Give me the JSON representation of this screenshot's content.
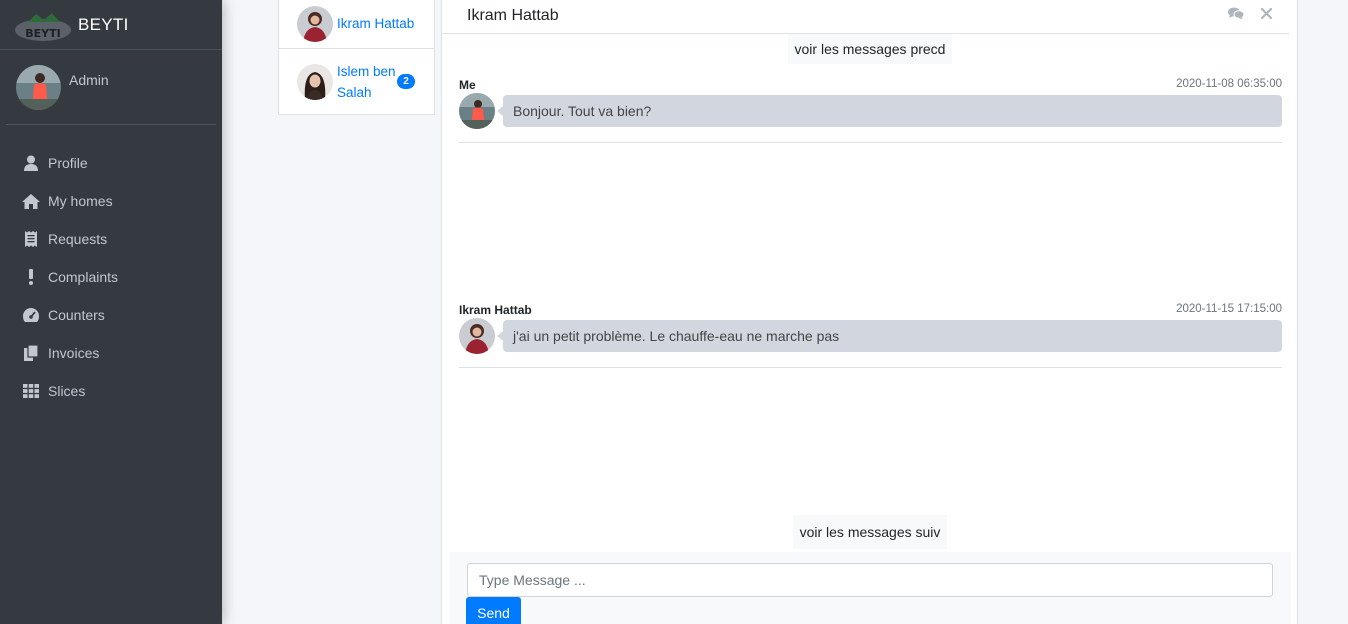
{
  "brand": {
    "name": "BEYTI",
    "logo_text": "BEYTI"
  },
  "user": {
    "name": "Admin"
  },
  "sidebar": {
    "items": [
      {
        "label": "Profile",
        "icon": "user-icon"
      },
      {
        "label": "My homes",
        "icon": "home-icon"
      },
      {
        "label": "Requests",
        "icon": "receipt-icon"
      },
      {
        "label": "Complaints",
        "icon": "exclamation-icon"
      },
      {
        "label": "Counters",
        "icon": "gauge-icon"
      },
      {
        "label": "Invoices",
        "icon": "copy-icon"
      },
      {
        "label": "Slices",
        "icon": "grid-icon"
      }
    ]
  },
  "conversations": [
    {
      "name": "Ikram Hattab",
      "badge": ""
    },
    {
      "name": "Islem ben Salah",
      "badge": "2"
    }
  ],
  "chat": {
    "title": "Ikram Hattab",
    "prev_label": "voir les messages precd",
    "next_label": "voir les messages suiv",
    "messages": [
      {
        "author": "Me",
        "time": "2020-11-08 06:35:00",
        "text": "Bonjour. Tout va bien?"
      },
      {
        "author": "Ikram Hattab",
        "time": "2020-11-15 17:15:00",
        "text": "j'ai un petit problème. Le chauffe-eau ne marche pas"
      }
    ],
    "input_placeholder": "Type Message ...",
    "send_label": "Send"
  },
  "colors": {
    "sidebar": "#343a40",
    "accent": "#007bff",
    "bubble": "#d2d6de"
  }
}
